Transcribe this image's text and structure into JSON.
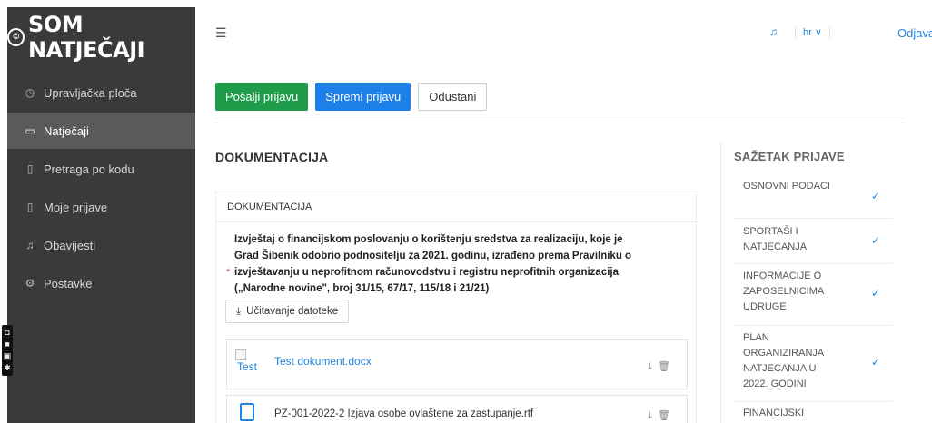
{
  "app": {
    "logo_text": "SOM NATJEČAJI",
    "logo_mark": "©"
  },
  "sidebar": {
    "items": [
      {
        "label": "Upravljačka ploča",
        "icon": "dashboard-icon",
        "glyph": "◷",
        "active": false
      },
      {
        "label": "Natječaji",
        "icon": "folder-icon",
        "glyph": "▭",
        "active": true
      },
      {
        "label": "Pretraga po kodu",
        "icon": "document-search-icon",
        "glyph": "▯",
        "active": false
      },
      {
        "label": "Moje prijave",
        "icon": "document-icon",
        "glyph": "▯",
        "active": false
      },
      {
        "label": "Obavijesti",
        "icon": "bell-icon",
        "glyph": "♫",
        "active": false
      },
      {
        "label": "Postavke",
        "icon": "settings-icon",
        "glyph": "⚙",
        "active": false
      }
    ]
  },
  "header": {
    "menu_toggle_icon": "menu-toggle-icon",
    "notification_icon": "bell-icon",
    "language": "hr ∨",
    "logout": "Odjava"
  },
  "actions": {
    "submit": "Pošalji prijavu",
    "save": "Spremi prijavu",
    "cancel": "Odustani",
    "colors": {
      "submit": "#1e9c4a",
      "save": "#1d7fe8"
    }
  },
  "main": {
    "section_title": "DOKUMENTACIJA",
    "card_title": "DOKUMENTACIJA",
    "requirement": {
      "required_marker": "*",
      "text": "Izvještaj o financijskom poslovanju o korištenju sredstva za realizaciju, koje je Grad Šibenik odobrio podnositelju za 2021. godinu, izrađeno prema Pravilniku o izvještavanju u neprofitnom računovodstvu i registru neprofitnih organizacija („Narodne novine\", broj 31/15, 67/17, 115/18 i 21/21)"
    },
    "upload_button": "Učitavanje datoteke",
    "files": [
      {
        "thumbnail_alt": "Test",
        "name": "Test dokument.docx",
        "is_link": true
      },
      {
        "name": "PZ-001-2022-2 Izjava osobe ovlaštene za zastupanje.rtf",
        "is_link": false
      }
    ]
  },
  "summary": {
    "title": "SAŽETAK PRIJAVE",
    "items": [
      {
        "label": "OSNOVNI PODACI",
        "done": true
      },
      {
        "label": "SPORTAŠI I NATJECANJA",
        "done": true
      },
      {
        "label": "INFORMACIJE O ZAPOSELNICIMA UDRUGE",
        "done": true
      },
      {
        "label": "PLAN ORGANIZIRANJA NATJECANJA U 2022. GODINI",
        "done": true
      },
      {
        "label": "FINANCIJSKI",
        "done": false
      }
    ],
    "check_glyph": "✓"
  }
}
